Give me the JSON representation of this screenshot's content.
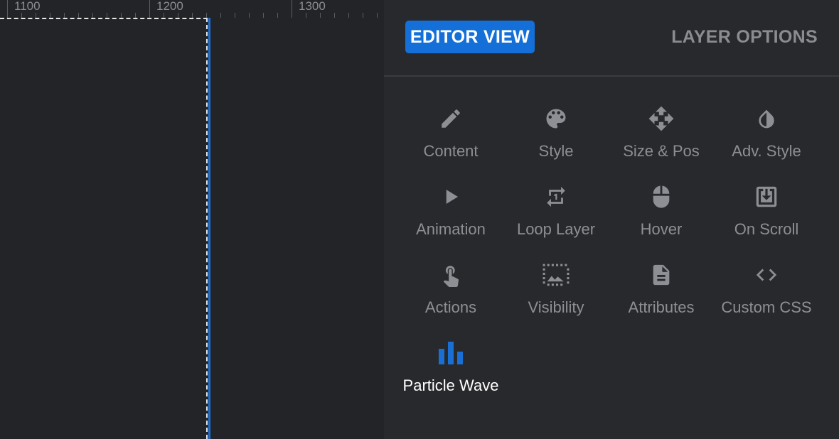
{
  "ruler": {
    "labels": [
      "1100",
      "1200",
      "1300"
    ]
  },
  "tabs": {
    "editor_view": "EDITOR VIEW",
    "layer_options": "LAYER OPTIONS"
  },
  "options": [
    {
      "label": "Content",
      "icon": "pencil-icon"
    },
    {
      "label": "Style",
      "icon": "palette-icon"
    },
    {
      "label": "Size & Pos",
      "icon": "move-icon"
    },
    {
      "label": "Adv. Style",
      "icon": "contrast-icon"
    },
    {
      "label": "Animation",
      "icon": "play-icon"
    },
    {
      "label": "Loop Layer",
      "icon": "repeat-one-icon"
    },
    {
      "label": "Hover",
      "icon": "mouse-icon"
    },
    {
      "label": "On Scroll",
      "icon": "download-box-icon"
    },
    {
      "label": "Actions",
      "icon": "touch-icon"
    },
    {
      "label": "Visibility",
      "icon": "image-select-icon"
    },
    {
      "label": "Attributes",
      "icon": "document-icon"
    },
    {
      "label": "Custom CSS",
      "icon": "code-icon"
    },
    {
      "label": "Particle Wave",
      "icon": "bar-chart-icon"
    }
  ],
  "colors": {
    "accent": "#1470d8",
    "icon_default": "#8d8f94",
    "icon_active": "#1a6fd4"
  }
}
